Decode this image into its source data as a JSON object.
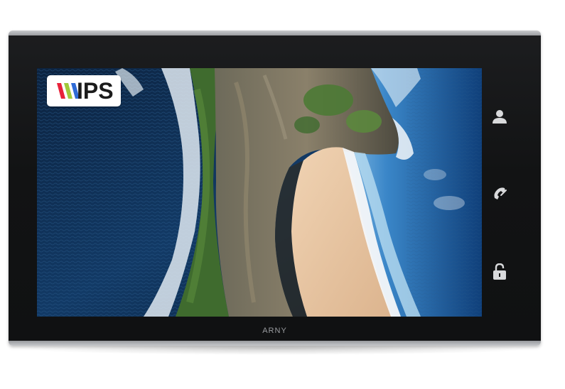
{
  "badge": {
    "text": "IPS",
    "stripe_colors": [
      "#e8233a",
      "#a1c93a",
      "#2f6bd6"
    ]
  },
  "device": {
    "brand": "ARNY"
  },
  "buttons": [
    {
      "name": "monitor-button",
      "icon": "person-icon"
    },
    {
      "name": "call-button",
      "icon": "handset-icon"
    },
    {
      "name": "unlock-button",
      "icon": "unlocked-padlock-icon"
    }
  ],
  "colors": {
    "bezel": "#141516",
    "frame_silver": "#c6c8cb",
    "icon": "#d9dadc",
    "ocean_deep": "#0f2a4a",
    "ocean_shallow": "#3a86c8",
    "sand": "#e9c9a6",
    "cliff": "#5b5a4f",
    "vegetation": "#3f6b2e"
  }
}
